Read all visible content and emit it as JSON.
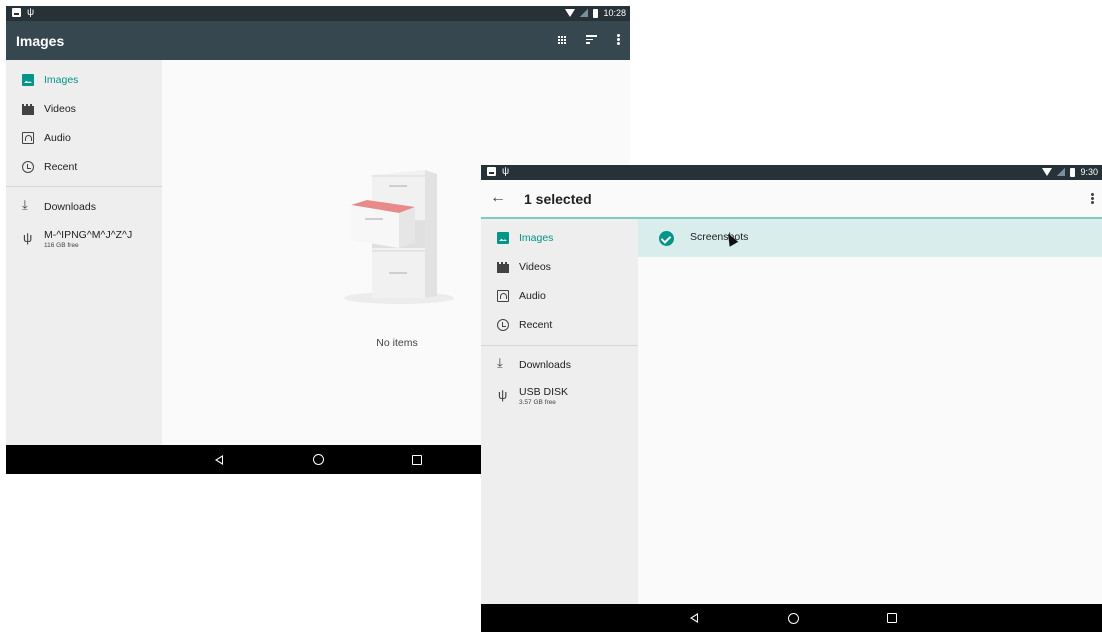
{
  "screen1": {
    "status": {
      "time": "10:28"
    },
    "toolbar": {
      "title": "Images"
    },
    "sidebar": {
      "items": [
        {
          "label": "Images",
          "icon": "image-icon",
          "active": true
        },
        {
          "label": "Videos",
          "icon": "video-icon"
        },
        {
          "label": "Audio",
          "icon": "audio-icon"
        },
        {
          "label": "Recent",
          "icon": "clock-icon"
        },
        {
          "label": "Downloads",
          "icon": "download-icon"
        },
        {
          "label": "M-^IPNG^M^J^Z^J",
          "sub": "116 GB free",
          "icon": "usb-icon"
        }
      ]
    },
    "content": {
      "empty_text": "No items"
    }
  },
  "screen2": {
    "status": {
      "time": "9:30"
    },
    "toolbar": {
      "title": "1 selected"
    },
    "sidebar": {
      "items": [
        {
          "label": "Images",
          "icon": "image-icon",
          "active": true
        },
        {
          "label": "Videos",
          "icon": "video-icon"
        },
        {
          "label": "Audio",
          "icon": "audio-icon"
        },
        {
          "label": "Recent",
          "icon": "clock-icon"
        },
        {
          "label": "Downloads",
          "icon": "download-icon"
        },
        {
          "label": "USB DISK",
          "sub": "3.57 GB free",
          "icon": "usb-icon"
        }
      ]
    },
    "content": {
      "rows": [
        {
          "label": "Screenshots",
          "selected": true
        }
      ]
    }
  },
  "colors": {
    "status_bar": "#263238",
    "toolbar": "#37474f",
    "accent": "#009688",
    "selected_row": "#d9eeec",
    "sidebar_bg": "#eeeeee",
    "navbar": "#000000"
  }
}
